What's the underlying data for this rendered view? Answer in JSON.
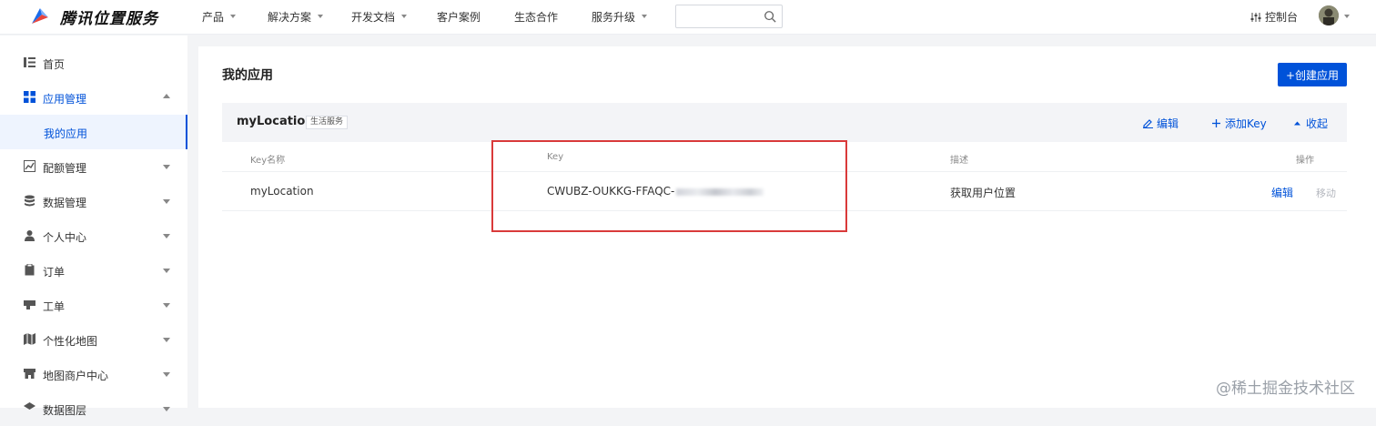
{
  "brand": {
    "name": "腾讯位置服务"
  },
  "topnav": {
    "items": [
      {
        "label": "产品",
        "dropdown": true
      },
      {
        "label": "解决方案",
        "dropdown": true
      },
      {
        "label": "开发文档",
        "dropdown": true
      },
      {
        "label": "客户案例",
        "dropdown": false
      },
      {
        "label": "生态合作",
        "dropdown": false
      },
      {
        "label": "服务升级",
        "dropdown": true
      }
    ],
    "search": {
      "value": "",
      "placeholder": ""
    },
    "console_label": "控制台"
  },
  "sidebar": {
    "items": [
      {
        "label": "首页",
        "icon": "list-icon"
      },
      {
        "label": "应用管理",
        "icon": "grid-icon",
        "expanded": true
      },
      {
        "label": "我的应用",
        "sub": true
      },
      {
        "label": "配额管理",
        "icon": "chart-icon"
      },
      {
        "label": "数据管理",
        "icon": "database-icon"
      },
      {
        "label": "个人中心",
        "icon": "user-icon"
      },
      {
        "label": "订单",
        "icon": "clipboard-icon"
      },
      {
        "label": "工单",
        "icon": "ticket-icon"
      },
      {
        "label": "个性化地图",
        "icon": "map-style-icon"
      },
      {
        "label": "地图商户中心",
        "icon": "store-icon"
      },
      {
        "label": "数据图层",
        "icon": "layer-icon"
      }
    ]
  },
  "main": {
    "title": "我的应用",
    "create_button": "+创建应用",
    "app": {
      "name": "myLocation",
      "tag": "生活服务",
      "actions": {
        "edit": "编辑",
        "add_key": "添加Key",
        "collapse": "收起"
      },
      "columns": {
        "key_name": "Key名称",
        "key": "Key",
        "desc": "描述",
        "ops": "操作"
      },
      "rows": [
        {
          "key_name": "myLocation",
          "key": "CWUBZ-OUKKG-FFAQC-",
          "desc": "获取用户位置",
          "op_edit": "编辑",
          "op_move": "移动"
        }
      ]
    }
  },
  "watermark": "@稀土掘金技术社区",
  "colors": {
    "accent": "#0052d9",
    "highlight": "#d93a3a"
  }
}
